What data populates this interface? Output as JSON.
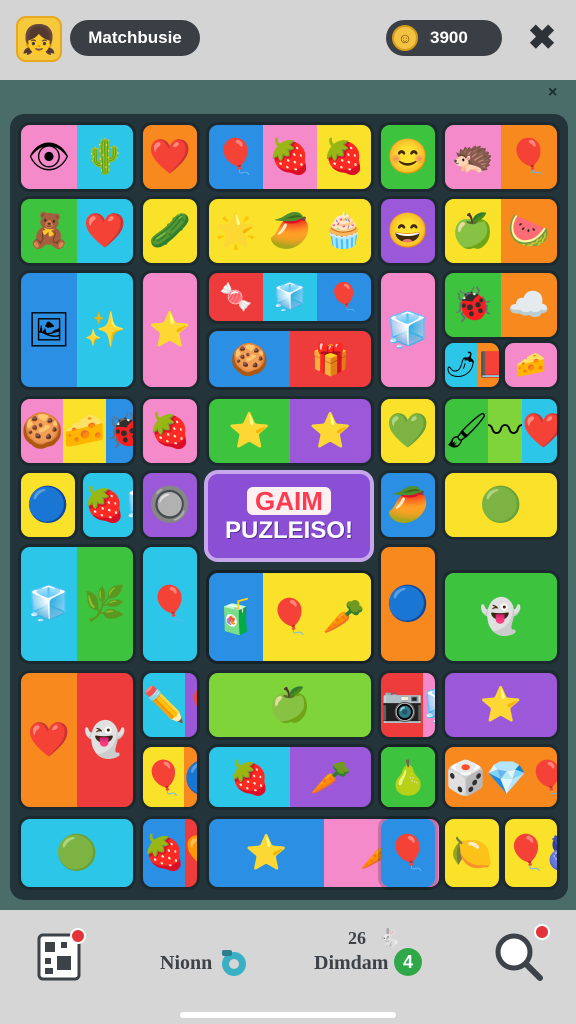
{
  "header": {
    "username": "Matchbusie",
    "coins": "3900",
    "close_symbol": "✖",
    "avatar_symbol": "👧",
    "coin_symbol": "☺"
  },
  "board": {
    "close_symbol": "×",
    "banner": {
      "title": "GAIM",
      "subtitle": "PUZLEISO!"
    }
  },
  "bottom": {
    "left_label": "Nionn",
    "center_label": "Dimdam",
    "center_count": "26",
    "center_badge": "4"
  },
  "palette": {
    "red": "#ee3b3b",
    "orange": "#f7891f",
    "yellow": "#fbe22a",
    "green": "#3ec33e",
    "blue": "#2b8fe3",
    "cyan": "#2cc7e8",
    "pink": "#f58acb",
    "purple": "#9b59d9",
    "lime": "#7fd43a"
  },
  "tiles": [
    {
      "cells": [
        {
          "c": "pink",
          "s": "👁"
        },
        {
          "c": "cyan",
          "s": "🌵"
        }
      ]
    },
    {
      "cells": [
        {
          "c": "orange",
          "s": "❤️"
        }
      ]
    },
    {
      "cells": [
        {
          "c": "blue",
          "s": "🎈"
        },
        {
          "c": "pink",
          "s": "🍓"
        },
        {
          "c": "yellow",
          "s": "🍓"
        }
      ]
    },
    {
      "cells": [
        {
          "c": "green",
          "s": "😊"
        }
      ]
    },
    {
      "cells": [
        {
          "c": "pink",
          "s": "🦔"
        },
        {
          "c": "orange",
          "s": "🎈"
        }
      ]
    },
    {
      "cells": [
        {
          "c": "green",
          "s": "🧸"
        },
        {
          "c": "cyan",
          "s": "❤️"
        }
      ]
    },
    {
      "cells": [
        {
          "c": "yellow",
          "s": "🥒"
        }
      ]
    },
    {
      "cells": [
        {
          "c": "yellow",
          "s": "🌟"
        },
        {
          "c": "yellow",
          "s": "🥭"
        },
        {
          "c": "yellow",
          "s": "🧁"
        }
      ]
    },
    {
      "cells": [
        {
          "c": "purple",
          "s": "😄"
        }
      ]
    },
    {
      "cells": [
        {
          "c": "yellow",
          "s": "🍏"
        },
        {
          "c": "orange",
          "s": "🍉"
        }
      ]
    },
    {
      "cells": [
        {
          "c": "green",
          "s": "🐞"
        },
        {
          "c": "orange",
          "s": "☁️"
        }
      ]
    },
    {
      "cells": [
        {
          "c": "blue",
          "s": "🖼"
        },
        {
          "c": "cyan",
          "s": "✨"
        }
      ]
    },
    {
      "cells": [
        {
          "c": "pink",
          "s": "⭐"
        }
      ]
    },
    {
      "cells": [
        {
          "c": "red",
          "s": "🍬"
        },
        {
          "c": "cyan",
          "s": "🧊"
        },
        {
          "c": "blue",
          "s": "🎈"
        }
      ]
    },
    {
      "cells": [
        {
          "c": "pink",
          "s": "🧊"
        }
      ]
    },
    {
      "cells": [
        {
          "c": "blue",
          "s": "🍪"
        },
        {
          "c": "red",
          "s": "🎁"
        }
      ]
    },
    {
      "cells": [
        {
          "c": "cyan",
          "s": "🌶"
        },
        {
          "c": "orange",
          "s": "📕"
        }
      ]
    },
    {
      "cells": [
        {
          "c": "pink",
          "s": "🧀"
        }
      ]
    },
    {
      "cells": [
        {
          "c": "pink",
          "s": "🍪"
        },
        {
          "c": "yellow",
          "s": "🧀"
        },
        {
          "c": "blue",
          "s": "🐞"
        }
      ]
    },
    {
      "cells": [
        {
          "c": "pink",
          "s": "🍓"
        }
      ]
    },
    {
      "cells": [
        {
          "c": "green",
          "s": "⭐"
        },
        {
          "c": "purple",
          "s": "⭐"
        }
      ]
    },
    {
      "cells": [
        {
          "c": "yellow",
          "s": "💚"
        }
      ]
    },
    {
      "cells": [
        {
          "c": "green",
          "s": "🖌"
        },
        {
          "c": "lime",
          "s": "〰"
        },
        {
          "c": "cyan",
          "s": "❤️"
        }
      ]
    },
    {
      "cells": [
        {
          "c": "yellow",
          "s": "🔵"
        }
      ]
    },
    {
      "cells": [
        {
          "c": "cyan",
          "s": "🍓"
        },
        {
          "c": "cyan",
          "s": "🧊"
        }
      ]
    },
    {
      "cells": [
        {
          "c": "purple",
          "s": "🔘"
        }
      ]
    },
    {
      "cells": [
        {
          "c": "blue",
          "s": "🥭"
        }
      ]
    },
    {
      "cells": [
        {
          "c": "yellow",
          "s": "🟢"
        }
      ]
    },
    {
      "cells": [
        {
          "c": "cyan",
          "s": "🎈"
        }
      ]
    },
    {
      "cells": [
        {
          "c": "blue",
          "s": "🎈"
        },
        {
          "c": "lime",
          "s": "🍍"
        }
      ]
    },
    {
      "cells": [
        {
          "c": "cyan",
          "s": "🧊"
        },
        {
          "c": "green",
          "s": "🌿"
        }
      ]
    },
    {
      "cells": [
        {
          "c": "orange",
          "s": "🔵"
        }
      ]
    },
    {
      "cells": [
        {
          "c": "blue",
          "s": "🧃"
        },
        {
          "c": "yellow",
          "s": "🎈"
        },
        {
          "c": "yellow",
          "s": "🥕"
        }
      ]
    },
    {
      "cells": [
        {
          "c": "green",
          "s": "👻"
        }
      ]
    },
    {
      "cells": [
        {
          "c": "orange",
          "s": "❤️"
        },
        {
          "c": "red",
          "s": "👻"
        }
      ]
    },
    {
      "cells": [
        {
          "c": "cyan",
          "s": "✏️"
        },
        {
          "c": "purple",
          "s": "🎈"
        }
      ]
    },
    {
      "cells": [
        {
          "c": "lime",
          "s": "🍏"
        }
      ]
    },
    {
      "cells": [
        {
          "c": "red",
          "s": "📷"
        },
        {
          "c": "pink",
          "s": "🧊"
        },
        {
          "c": "pink",
          "s": "🍕"
        }
      ]
    },
    {
      "cells": [
        {
          "c": "purple",
          "s": "⭐"
        }
      ]
    },
    {
      "cells": [
        {
          "c": "yellow",
          "s": "🎈"
        },
        {
          "c": "orange",
          "s": "🔵"
        }
      ]
    },
    {
      "cells": [
        {
          "c": "cyan",
          "s": "🍓"
        },
        {
          "c": "purple",
          "s": "🥕"
        }
      ]
    },
    {
      "cells": [
        {
          "c": "yellow",
          "s": "❤️"
        }
      ]
    },
    {
      "cells": [
        {
          "c": "orange",
          "s": "🎲"
        },
        {
          "c": "orange",
          "s": "💎"
        },
        {
          "c": "orange",
          "s": "🎈"
        }
      ]
    },
    {
      "cells": [
        {
          "c": "cyan",
          "s": "🟢"
        }
      ]
    },
    {
      "cells": [
        {
          "c": "blue",
          "s": "🍓"
        },
        {
          "c": "red",
          "s": "🧡"
        }
      ]
    },
    {
      "cells": [
        {
          "c": "blue",
          "s": "⭐"
        },
        {
          "c": "pink",
          "s": "🥕"
        }
      ]
    },
    {
      "cells": [
        {
          "c": "yellow",
          "s": "🍋"
        }
      ]
    },
    {
      "cells": [
        {
          "c": "yellow",
          "s": "🎈"
        },
        {
          "c": "yellow",
          "s": "🫐"
        },
        {
          "c": "orange",
          "s": "📐"
        }
      ]
    },
    {
      "cells": [
        {
          "c": "green",
          "s": "🍐"
        }
      ]
    },
    {
      "cells": [
        {
          "c": "blue",
          "s": "🎈"
        }
      ]
    }
  ]
}
